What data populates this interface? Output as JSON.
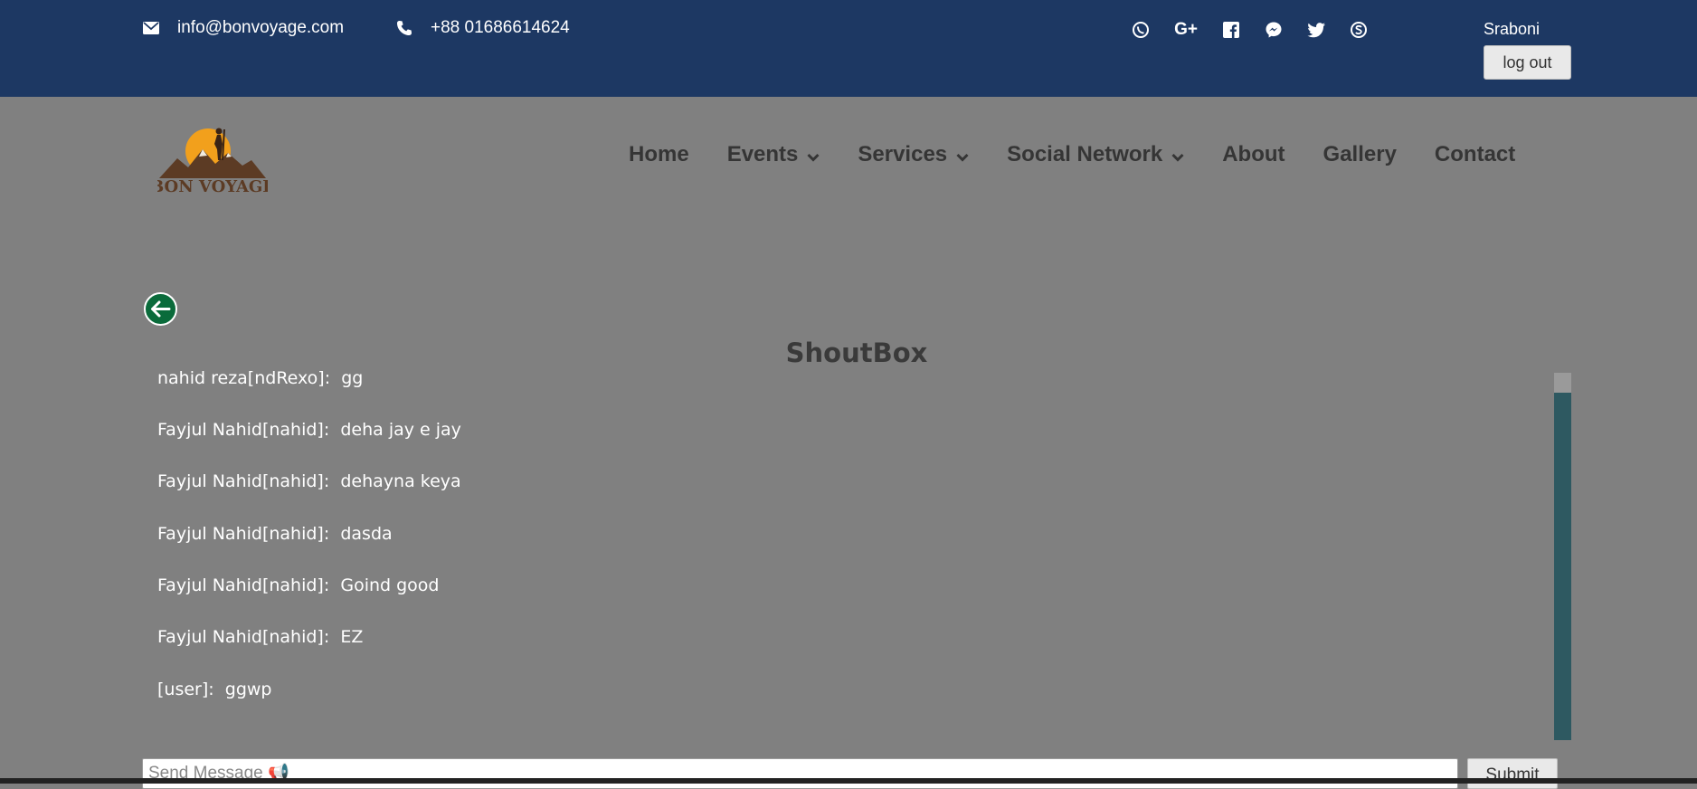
{
  "topbar": {
    "email": "info@bonvoyage.com",
    "phone": "+88 01686614624",
    "social_icons": [
      "viber-icon",
      "google-plus-icon",
      "facebook-icon",
      "messenger-icon",
      "twitter-icon",
      "skype-icon"
    ],
    "user_name": "Sraboni",
    "logout_label": "log out",
    "background_color": "#1d3863"
  },
  "navbar": {
    "items": [
      {
        "label": "Home",
        "dropdown": false
      },
      {
        "label": "Events",
        "dropdown": true
      },
      {
        "label": "Services",
        "dropdown": true
      },
      {
        "label": "Social Network",
        "dropdown": true
      },
      {
        "label": "About",
        "dropdown": false
      },
      {
        "label": "Gallery",
        "dropdown": false
      },
      {
        "label": "Contact",
        "dropdown": false
      }
    ],
    "logo_text": "BON VOYAGE"
  },
  "shoutbox": {
    "title": "ShoutBox",
    "messages": [
      {
        "user": "nahid reza[ndRexo]:",
        "text": "gg"
      },
      {
        "user": "Fayjul Nahid[nahid]:",
        "text": "deha jay e jay"
      },
      {
        "user": "Fayjul Nahid[nahid]:",
        "text": "dehayna keya"
      },
      {
        "user": "Fayjul Nahid[nahid]:",
        "text": "dasda"
      },
      {
        "user": "Fayjul Nahid[nahid]:",
        "text": "Goind good"
      },
      {
        "user": "Fayjul Nahid[nahid]:",
        "text": "EZ"
      },
      {
        "user": "[user]:",
        "text": "ggwp"
      }
    ],
    "input_placeholder": "Send Message 📢",
    "submit_label": "Submit",
    "scrollbar_color": "#2e5961"
  }
}
